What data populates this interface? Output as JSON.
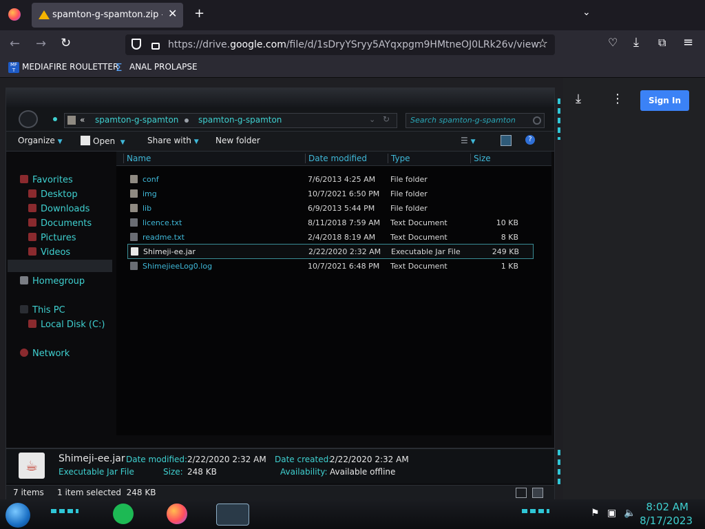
{
  "browser": {
    "tab_title": "spamton-g-spamton.zip - Goog",
    "url_prefix": "https://drive.",
    "url_domain": "google.com",
    "url_path": "/file/d/1sDryYSryy5AYqxpgm9HMtneOJ0LRk26v/view",
    "bookmarks": [
      "MEDIAFIRE ROULETTER",
      "ANAL PROLAPSE"
    ],
    "icons": {
      "new_tab": "plus-icon",
      "back": "arrow-left-icon",
      "forward": "arrow-right-icon",
      "reload": "reload-icon",
      "shield": "shield-icon",
      "lock": "lock-icon",
      "star": "star-icon",
      "pocket": "pocket-icon",
      "downloads": "download-icon",
      "extensions": "puzzle-icon",
      "menu": "hamburger-menu-icon"
    }
  },
  "drive": {
    "sign_in": "Sign In",
    "colors": {
      "sign_in": "#3b82f6"
    }
  },
  "explorer": {
    "breadcrumb": [
      "spamton-g-spamton",
      "spamton-g-spamton"
    ],
    "back_marker": "«",
    "search_placeholder": "Search spamton-g-spamton",
    "toolbar": {
      "organize": "Organize",
      "open": "Open",
      "share_with": "Share with",
      "new_folder": "New folder",
      "help": "?"
    },
    "nav": {
      "favorites": "Favorites",
      "desktop": "Desktop",
      "downloads": "Downloads",
      "documents": "Documents",
      "pictures": "Pictures",
      "videos": "Videos",
      "homegroup": "Homegroup",
      "this_pc": "This PC",
      "local_disk": "Local Disk (C:)",
      "network": "Network"
    },
    "columns": [
      "Name",
      "Date modified",
      "Type",
      "Size"
    ],
    "files": [
      {
        "name": "conf",
        "date": "7/6/2013 4:25 AM",
        "type": "File folder",
        "size": ""
      },
      {
        "name": "img",
        "date": "10/7/2021 6:50 PM",
        "type": "File folder",
        "size": ""
      },
      {
        "name": "lib",
        "date": "6/9/2013 5:44 PM",
        "type": "File folder",
        "size": ""
      },
      {
        "name": "licence.txt",
        "date": "8/11/2018 7:59 AM",
        "type": "Text Document",
        "size": "10 KB"
      },
      {
        "name": "readme.txt",
        "date": "2/4/2018 8:19 AM",
        "type": "Text Document",
        "size": "8 KB"
      },
      {
        "name": "Shimeji-ee.jar",
        "date": "2/22/2020 2:32 AM",
        "type": "Executable Jar File",
        "size": "249 KB"
      },
      {
        "name": "ShimejieeLog0.log",
        "date": "10/7/2021 6:48 PM",
        "type": "Text Document",
        "size": "1 KB"
      }
    ],
    "selected_index": 5,
    "details": {
      "name": "Shimeji-ee.jar",
      "type": "Executable Jar File",
      "date_modified_label": "Date modified:",
      "date_modified": "2/22/2020 2:32 AM",
      "size_label": "Size:",
      "size": "248 KB",
      "date_created_label": "Date created:",
      "date_created": "2/22/2020 2:32 AM",
      "availability_label": "Availability:",
      "availability": "Available offline"
    },
    "status": {
      "items": "7 items",
      "selection": "1 item selected  248 KB"
    },
    "colors": {
      "accent": "#3fd0d0"
    }
  },
  "taskbar": {
    "time": "8:02 AM",
    "date": "8/17/2023",
    "apps": [
      "notes-app-icon",
      "firefox-icon",
      "file-explorer-icon"
    ],
    "tray": [
      "flag-icon",
      "network-icon",
      "speaker-icon"
    ]
  }
}
